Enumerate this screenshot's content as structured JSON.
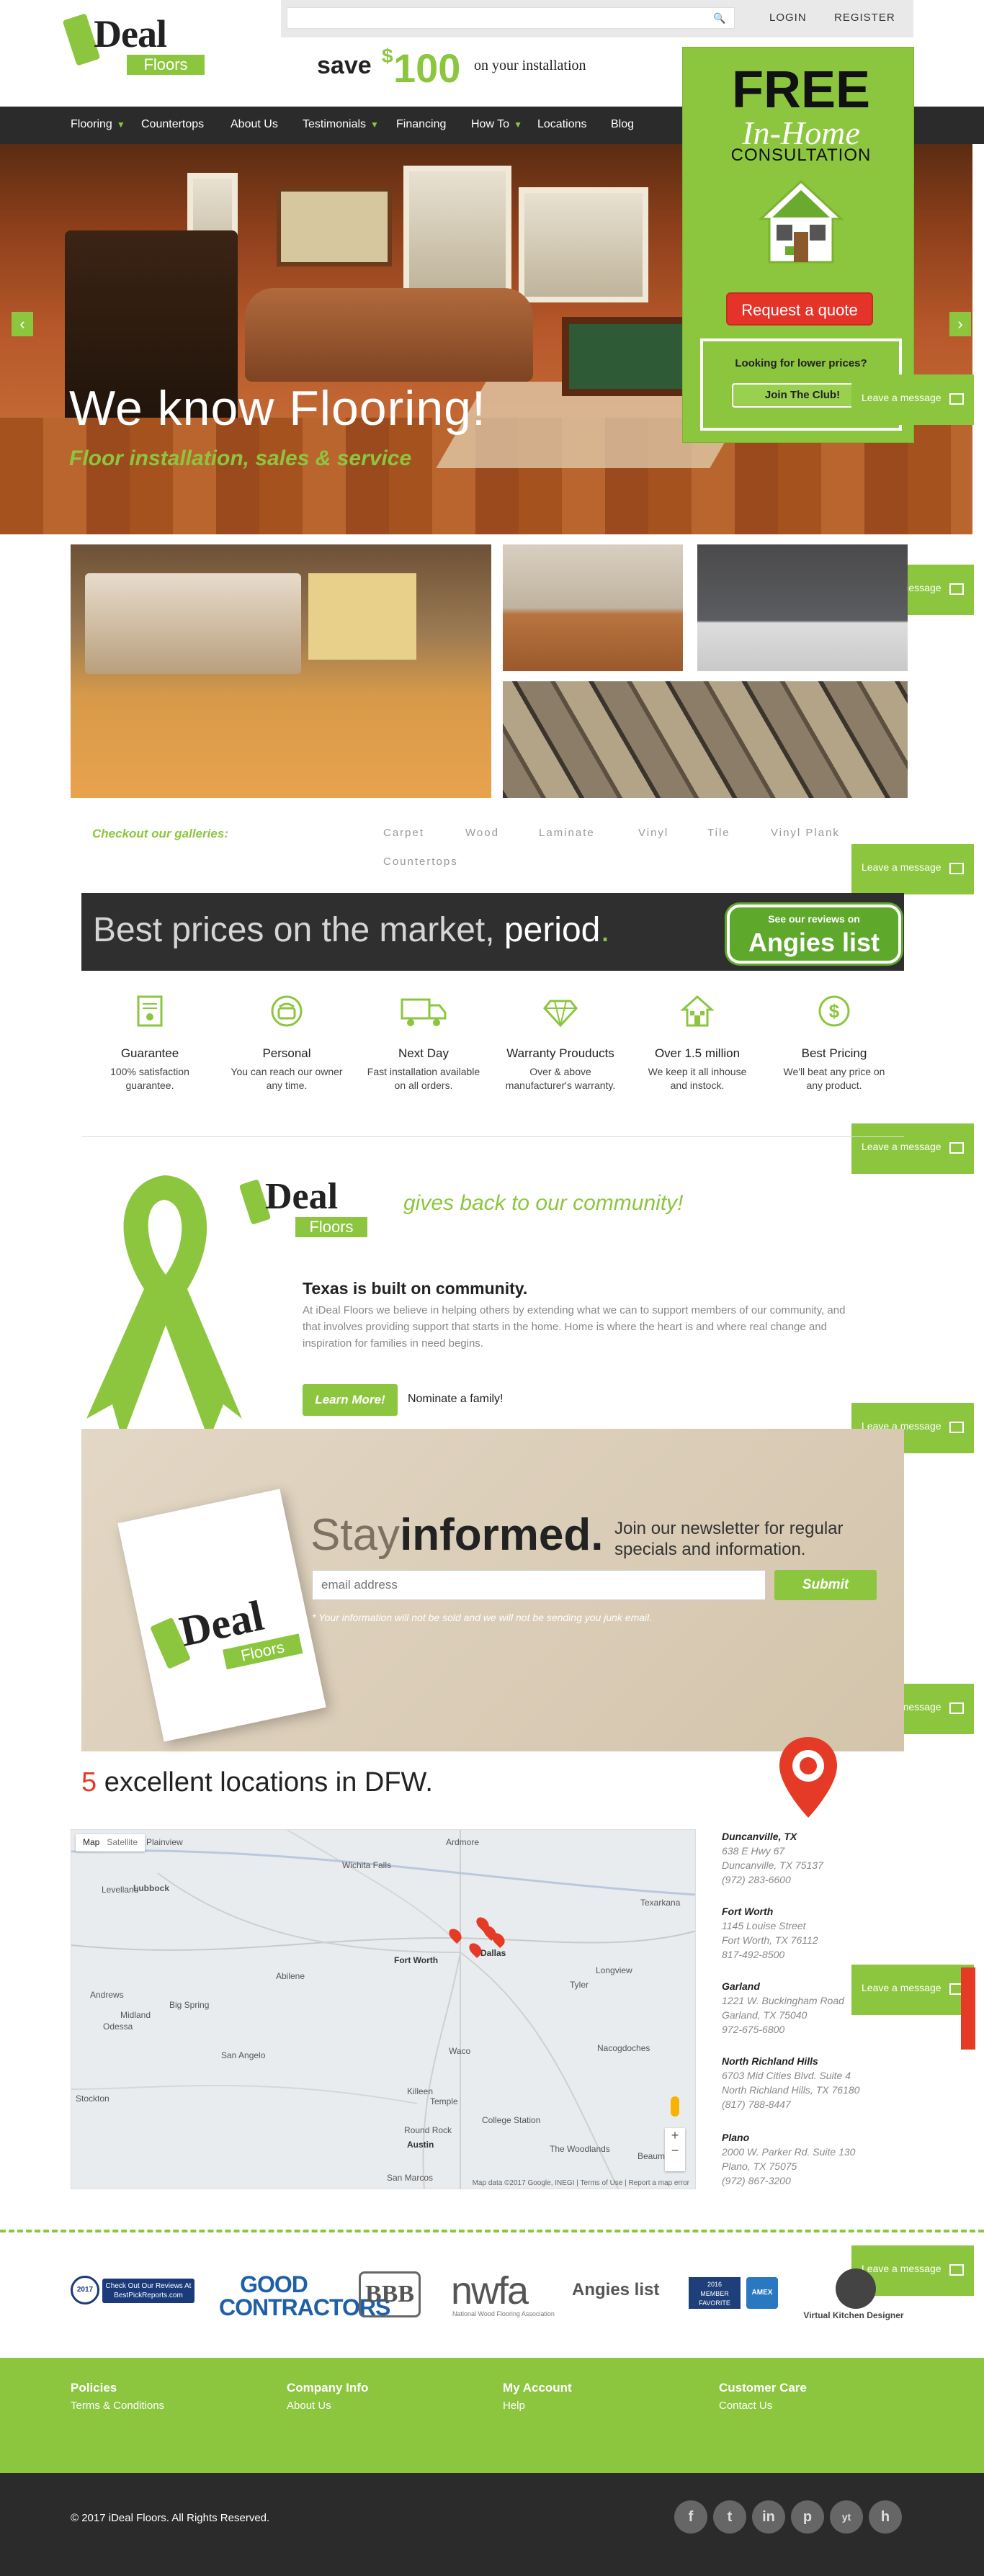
{
  "header": {
    "logo_main": "Deal",
    "logo_sub": "Floors",
    "search_placeholder": "",
    "login": "LOGIN",
    "register": "REGISTER",
    "promo_save": "save",
    "promo_dollar": "$",
    "promo_amount": "100",
    "promo_rest": "on your installation"
  },
  "nav": {
    "items": [
      "Flooring",
      "Countertops",
      "About Us",
      "Testimonials",
      "Financing",
      "How To",
      "Locations",
      "Blog"
    ]
  },
  "hero": {
    "title": "We know Flooring!",
    "subtitle": "Floor installation, sales & service",
    "prev": "‹",
    "next": "›"
  },
  "promo": {
    "free": "FREE",
    "in_home": "In-Home",
    "consultation": "CONSULTATION",
    "quote_button": "Request a quote",
    "club_question": "Looking for lower prices?",
    "club_button": "Join The Club!"
  },
  "message_label": "Leave a message",
  "galleries": {
    "label": "Checkout our galleries:",
    "links": [
      "Carpet",
      "Wood",
      "Laminate",
      "Vinyl",
      "Tile",
      "Vinyl Plank",
      "Countertops"
    ]
  },
  "prices_banner": {
    "text_light": "Best prices on the market, ",
    "text_bold": "period",
    "text_dot": ".",
    "angies_top": "See our reviews on",
    "angies_main": "Angies list"
  },
  "features": [
    {
      "title": "Guarantee",
      "desc": "100% satisfaction guarantee."
    },
    {
      "title": "Personal",
      "desc": "You can reach our owner any time."
    },
    {
      "title": "Next Day",
      "desc": "Fast installation available on all orders."
    },
    {
      "title": "Warranty Prouducts",
      "desc": "Over & above manufacturer's warranty."
    },
    {
      "title": "Over 1.5 million",
      "desc": "We keep it all inhouse and instock."
    },
    {
      "title": "Best Pricing",
      "desc": "We'll beat any price on any product."
    }
  ],
  "community": {
    "tagline": "gives back to our community!",
    "heading": "Texas is built on community.",
    "body": "At iDeal Floors we believe in helping others by extending what we can to support members of our community, and that involves providing support that starts in the home. Home is where the heart is and where real change and inspiration for families in need begins.",
    "learn_more": "Learn More!",
    "nominate": "Nominate a family!"
  },
  "newsletter": {
    "stay": "Stay",
    "informed": "informed.",
    "join": "Join our newsletter for regular specials and information.",
    "email_placeholder": "email address",
    "submit": "Submit",
    "disclaimer": "* Your information will not be sold and we will not be sending you junk email."
  },
  "locations": {
    "count": "5",
    "heading": " excellent locations in DFW.",
    "map_type": "Map",
    "map_satellite": "Satellite",
    "map_footer": "Map data ©2017 Google, INEGI | Terms of Use | Report a map error",
    "map_cities": [
      "Lubbock",
      "Wichita Falls",
      "Ardmore",
      "Texarkana",
      "Fort Worth",
      "Dallas",
      "Abilene",
      "Tyler",
      "Longview",
      "Midland",
      "Odessa",
      "Big Spring",
      "San Angelo",
      "Waco",
      "Killeen",
      "Temple",
      "Round Rock",
      "Austin",
      "College Station",
      "Nacogdoches",
      "Beaumo",
      "Stockton",
      "Andrews",
      "Levelland",
      "San Marcos",
      "The Woodlands",
      "Plainview"
    ],
    "branches": [
      {
        "name": "Duncanville, TX",
        "lines": [
          "638 E Hwy 67",
          "Duncanville, TX 75137",
          "(972) 283-6600"
        ]
      },
      {
        "name": "Fort Worth",
        "lines": [
          "1145 Louise Street",
          "Fort Worth, TX 76112",
          "817-492-8500"
        ]
      },
      {
        "name": "Garland",
        "lines": [
          "1221 W. Buckingham Road",
          "Garland, TX 75040",
          "972-675-6800"
        ]
      },
      {
        "name": "North Richland Hills",
        "lines": [
          "6703 Mid Cities Blvd. Suite 4",
          "North Richland Hills, TX 76180",
          "(817) 788-8447"
        ]
      },
      {
        "name": "Plano",
        "lines": [
          "2000 W. Parker Rd. Suite 130",
          "Plano, TX 75075",
          "(972) 867-3200"
        ]
      }
    ]
  },
  "badges": {
    "bestpick_year": "2017",
    "bestpick": "Check Out Our Reviews At BestPickReports.com",
    "good_contractors": "GOOD CONTRACTORS",
    "bbb": "BBB",
    "nwfa": "nwfa",
    "nwfa_sub": "National Wood Flooring Association",
    "angies": "Angies list",
    "member_favorite_year": "2016",
    "member_favorite": "MEMBER FAVORITE",
    "amex": "AMEX",
    "kitchen": "Virtual Kitchen Designer"
  },
  "footer": {
    "columns": [
      {
        "heading": "Policies",
        "link": "Terms & Conditions"
      },
      {
        "heading": "Company Info",
        "link": "About Us"
      },
      {
        "heading": "My Account",
        "link": "Help"
      },
      {
        "heading": "Customer Care",
        "link": "Contact Us"
      }
    ],
    "copyright": "© 2017 iDeal Floors. All Rights Reserved.",
    "social": [
      "f",
      "t",
      "in",
      "p",
      "yt",
      "h"
    ]
  }
}
